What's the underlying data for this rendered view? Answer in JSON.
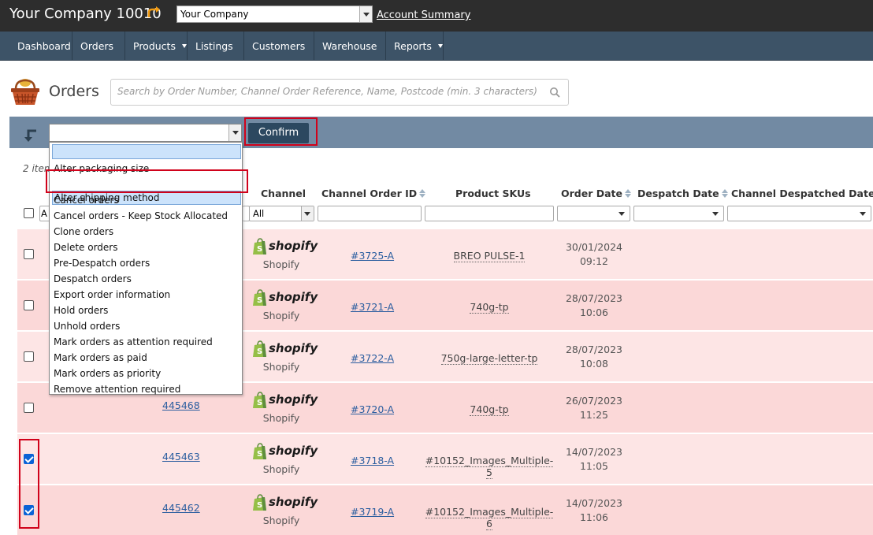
{
  "header": {
    "company_title": "Your Company 10010",
    "company_select_value": "Your Company",
    "account_link": "Account Summary"
  },
  "nav": {
    "items": [
      {
        "label": "Dashboard",
        "has_menu": false
      },
      {
        "label": "Orders",
        "has_menu": true
      },
      {
        "label": "Products",
        "has_menu": true
      },
      {
        "label": "Listings",
        "has_menu": true
      },
      {
        "label": "Customers",
        "has_menu": true
      },
      {
        "label": "Warehouse",
        "has_menu": true
      },
      {
        "label": "Reports",
        "has_menu": true
      }
    ]
  },
  "page": {
    "title": "Orders",
    "search_placeholder": "Search by Order Number, Channel Order Reference, Name, Postcode (min. 3 characters)"
  },
  "actions": {
    "confirm_label": "Confirm",
    "dropdown_options": [
      "Alter packaging size",
      "Alter shipping method",
      "Cancel orders",
      "Cancel orders - Keep Stock Allocated",
      "Clone orders",
      "Delete orders",
      "Pre-Despatch orders",
      "Despatch orders",
      "Export order information",
      "Hold orders",
      "Unhold orders",
      "Mark orders as attention required",
      "Mark orders as paid",
      "Mark orders as priority",
      "Remove attention required"
    ],
    "selected_option": "Alter shipping method"
  },
  "table": {
    "items_count_partial": "2 item",
    "columns": {
      "channel": "Channel",
      "channel_order_id": "Channel Order ID",
      "product_skus": "Product SKUs",
      "order_date": "Order Date",
      "despatch_date": "Despatch Date",
      "channel_despatched_date": "Channel Despatched Date"
    },
    "filters": {
      "channel_value": "All",
      "col1_partial": "A"
    },
    "rows": [
      {
        "order_number": "",
        "channel_logo": "shopify",
        "channel": "Shopify",
        "channel_order_id": "#3725-A",
        "sku": "BREO PULSE-1",
        "date": "30/01/2024",
        "time": "09:12",
        "checked": false
      },
      {
        "order_number": "",
        "channel_logo": "shopify",
        "channel": "Shopify",
        "channel_order_id": "#3721-A",
        "sku": "740g-tp",
        "date": "28/07/2023",
        "time": "10:06",
        "checked": false
      },
      {
        "order_number": "",
        "channel_logo": "shopify",
        "channel": "Shopify",
        "channel_order_id": "#3722-A",
        "sku": "750g-large-letter-tp",
        "date": "28/07/2023",
        "time": "10:08",
        "checked": false
      },
      {
        "order_number": "445468",
        "channel_logo": "shopify",
        "channel": "Shopify",
        "channel_order_id": "#3720-A",
        "sku": "740g-tp",
        "date": "26/07/2023",
        "time": "11:25",
        "checked": false
      },
      {
        "order_number": "445463",
        "channel_logo": "shopify",
        "channel": "Shopify",
        "channel_order_id": "#3718-A",
        "sku": "#10152_Images_Multiple-5",
        "date": "14/07/2023",
        "time": "11:05",
        "checked": true
      },
      {
        "order_number": "445462",
        "channel_logo": "shopify",
        "channel": "Shopify",
        "channel_order_id": "#3719-A",
        "sku": "#10152_Images_Multiple-6",
        "date": "14/07/2023",
        "time": "11:06",
        "checked": true
      }
    ]
  },
  "colors": {
    "topbar": "#2d2d2d",
    "navbar": "#3d5367",
    "actionbar": "#728aa3",
    "confirm_button": "#2c4860",
    "row_light": "#fde5e5",
    "row_dark": "#fbd8d8",
    "highlight": "#d0021b",
    "link": "#2a5d9f",
    "shopify_green": "#95bf47"
  }
}
